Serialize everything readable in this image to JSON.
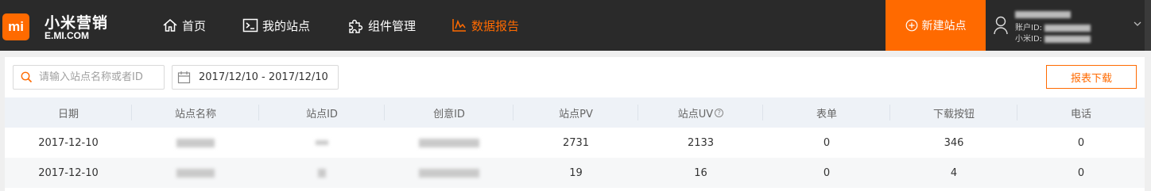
{
  "brand": {
    "logo_text": "mi",
    "name_cn": "小米营销",
    "name_en": "E.MI.COM"
  },
  "nav": [
    {
      "label": "首页",
      "icon": "home-icon",
      "active": false
    },
    {
      "label": "我的站点",
      "icon": "terminal-icon",
      "active": false
    },
    {
      "label": "组件管理",
      "icon": "puzzle-icon",
      "active": false
    },
    {
      "label": "数据报告",
      "icon": "chart-icon",
      "active": true
    }
  ],
  "new_site_label": "新建站点",
  "account": {
    "account_label": "账户ID:",
    "mi_label": "小米ID:"
  },
  "toolbar": {
    "search_placeholder": "请输入站点名称或者ID",
    "date_range": "2017/12/10 - 2017/12/10",
    "export_label": "报表下载"
  },
  "table": {
    "headers": [
      "日期",
      "站点名称",
      "站点ID",
      "创意ID",
      "站点PV",
      "站点UV",
      "表单",
      "下载按钮",
      "电话"
    ],
    "rows": [
      {
        "date": "2017-12-10",
        "pv": "2731",
        "uv": "2133",
        "form": "0",
        "download": "346",
        "phone": "0"
      },
      {
        "date": "2017-12-10",
        "pv": "19",
        "uv": "16",
        "form": "0",
        "download": "4",
        "phone": "0"
      }
    ]
  },
  "colors": {
    "accent": "#ff6a00",
    "topbar": "#2a2a2a"
  }
}
